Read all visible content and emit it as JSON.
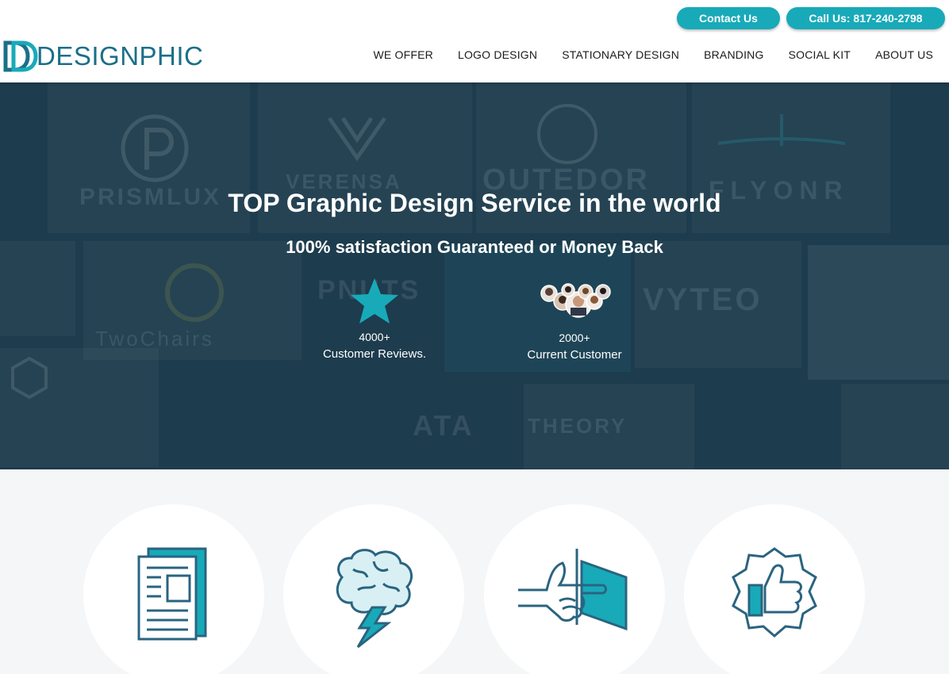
{
  "header": {
    "contact_label": "Contact Us",
    "call_label": "Call Us: 817-240-2798",
    "logo_text": "DESIGNPHIC",
    "nav": [
      "WE OFFER",
      "LOGO DESIGN",
      "STATIONARY DESIGN",
      "BRANDING",
      "SOCIAL KIT",
      "ABOUT US"
    ]
  },
  "hero": {
    "title": "TOP Graphic Design Service in the world",
    "subtitle": "100% satisfaction Guaranteed or Money Back",
    "stats": [
      {
        "count": "4000+",
        "label": "Customer Reviews.",
        "icon": "star-icon"
      },
      {
        "count": "2000+",
        "label": "Current Customer",
        "icon": "customer-avatars-icon"
      }
    ],
    "background_words": [
      "PRISMLUX",
      "VERENSA",
      "OUTEDOR",
      "FLYONR",
      "PNUTS",
      "VYTEO",
      "TwoChairs",
      "ATA",
      "THEORY"
    ]
  },
  "features": {
    "icons": [
      "document-icon",
      "brain-lightning-icon",
      "pointing-hand-icon",
      "thumbs-up-badge-icon"
    ]
  },
  "colors": {
    "accent": "#18aab9",
    "brand": "#1b6f89",
    "hero_bg": "#1d3c4d",
    "icon_stroke": "#2a6480"
  }
}
